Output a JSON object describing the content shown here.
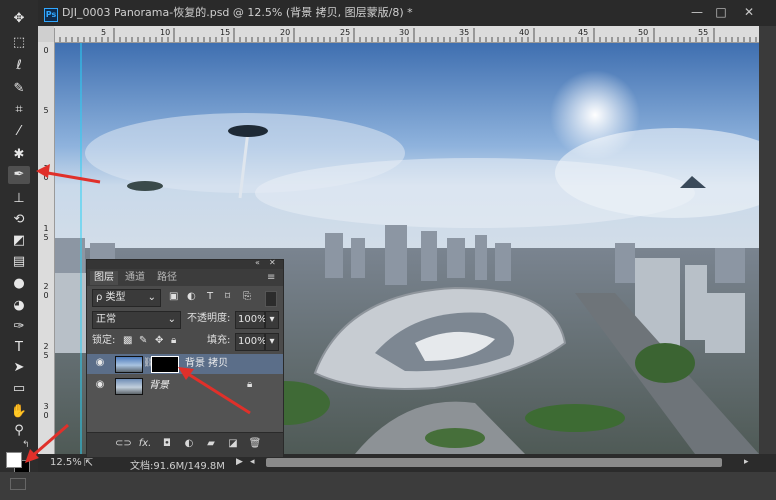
{
  "titlebar": {
    "ps_logo": "Ps",
    "doc_title": "DJI_0003 Panorama-恢复的.psd @ 12.5% (背景 拷贝, 图层蒙版/8) *",
    "minimize": "—",
    "maximize": "□",
    "close": "✕"
  },
  "toolbar": {
    "tools": [
      "move-tool",
      "marquee-tool",
      "lasso-tool",
      "quick-select-tool",
      "crop-tool",
      "eyedropper-tool",
      "spot-heal-tool",
      "brush-tool",
      "stamp-tool",
      "history-brush-tool",
      "eraser-tool",
      "gradient-tool",
      "blur-tool",
      "dodge-tool",
      "pen-tool",
      "type-tool",
      "path-select-tool",
      "shape-tool",
      "hand-tool",
      "zoom-tool"
    ],
    "active_tool": "brush-tool",
    "foreground_color": "#ffffff",
    "background_color": "#000000"
  },
  "rulers": {
    "h_ticks": [
      "5",
      "10",
      "15",
      "20",
      "25",
      "30",
      "35",
      "40",
      "45",
      "50",
      "55"
    ],
    "v_ticks": [
      "0",
      "5",
      "1 0",
      "1 5",
      "2 0",
      "2 5",
      "3 0"
    ]
  },
  "layers_panel": {
    "collapse": "«",
    "close": "✕",
    "tabs": [
      "图层",
      "通道",
      "路径"
    ],
    "active_tab": "图层",
    "menu_icon": "≡",
    "filter_label": "ρ 类型",
    "blend_mode": "正常",
    "opacity_label": "不透明度:",
    "opacity_value": "100%",
    "lock_label": "锁定:",
    "fill_label": "填充:",
    "fill_value": "100%",
    "layers": [
      {
        "name": "背景 拷贝",
        "visible": true,
        "selected": true,
        "has_mask": true
      },
      {
        "name": "背景",
        "visible": true,
        "selected": false,
        "locked": true
      }
    ],
    "footer": [
      "link-icon",
      "fx-icon",
      "mask-icon",
      "adjustment-icon",
      "group-icon",
      "new-layer-icon",
      "trash-icon"
    ],
    "footer_fx": "fx."
  },
  "statusbar": {
    "zoom": "12.5%",
    "doc_info": "文档:91.6M/149.8M"
  },
  "annotation_color": "#e0302a"
}
